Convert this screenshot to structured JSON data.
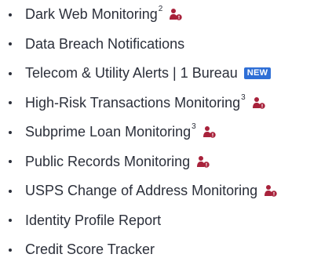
{
  "features": [
    {
      "label": "Dark Web Monitoring",
      "sup": "2",
      "icon": "person-alert-icon"
    },
    {
      "label": "Data Breach Notifications",
      "sup": "",
      "icon": ""
    },
    {
      "label": "Telecom & Utility Alerts | 1 Bureau",
      "sup": "",
      "icon": "",
      "badge": "NEW"
    },
    {
      "label": "High-Risk Transactions Monitoring",
      "sup": "3",
      "icon": "person-alert-icon"
    },
    {
      "label": "Subprime Loan Monitoring",
      "sup": "3",
      "icon": "person-alert-icon"
    },
    {
      "label": "Public Records Monitoring",
      "sup": "",
      "icon": "person-alert-icon"
    },
    {
      "label": "USPS Change of Address Monitoring",
      "sup": "",
      "icon": "person-alert-icon"
    },
    {
      "label": "Identity Profile Report",
      "sup": "",
      "icon": ""
    },
    {
      "label": "Credit Score Tracker",
      "sup": "",
      "icon": ""
    }
  ],
  "colors": {
    "text": "#2b2f3a",
    "icon": "#a8223b",
    "badge": "#2f6fd6"
  }
}
